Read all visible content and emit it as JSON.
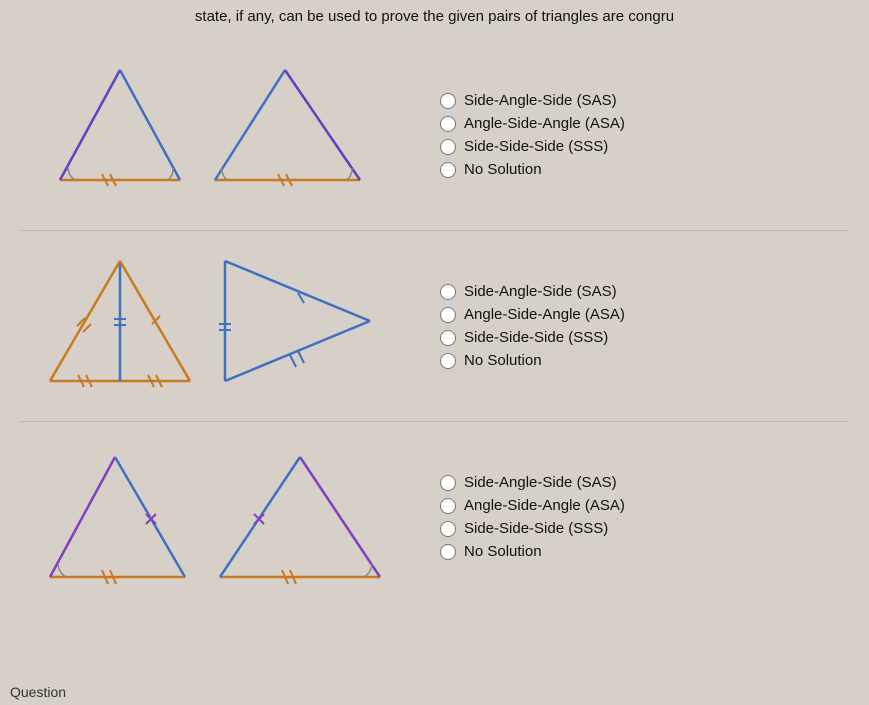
{
  "header": {
    "text": "state, if any, can be used to prove the given pairs of triangles are congru"
  },
  "rows": [
    {
      "id": "row1",
      "options": [
        "Side-Angle-Side (SAS)",
        "Angle-Side-Angle (ASA)",
        "Side-Side-Side (SSS)",
        "No Solution"
      ]
    },
    {
      "id": "row2",
      "options": [
        "Side-Angle-Side (SAS)",
        "Angle-Side-Angle (ASA)",
        "Side-Side-Side (SSS)",
        "No Solution"
      ]
    },
    {
      "id": "row3",
      "options": [
        "Side-Angle-Side (SAS)",
        "Angle-Side-Angle (ASA)",
        "Side-Side-Side (SSS)",
        "No Solution"
      ]
    }
  ],
  "footer": {
    "question_label": "Question"
  }
}
